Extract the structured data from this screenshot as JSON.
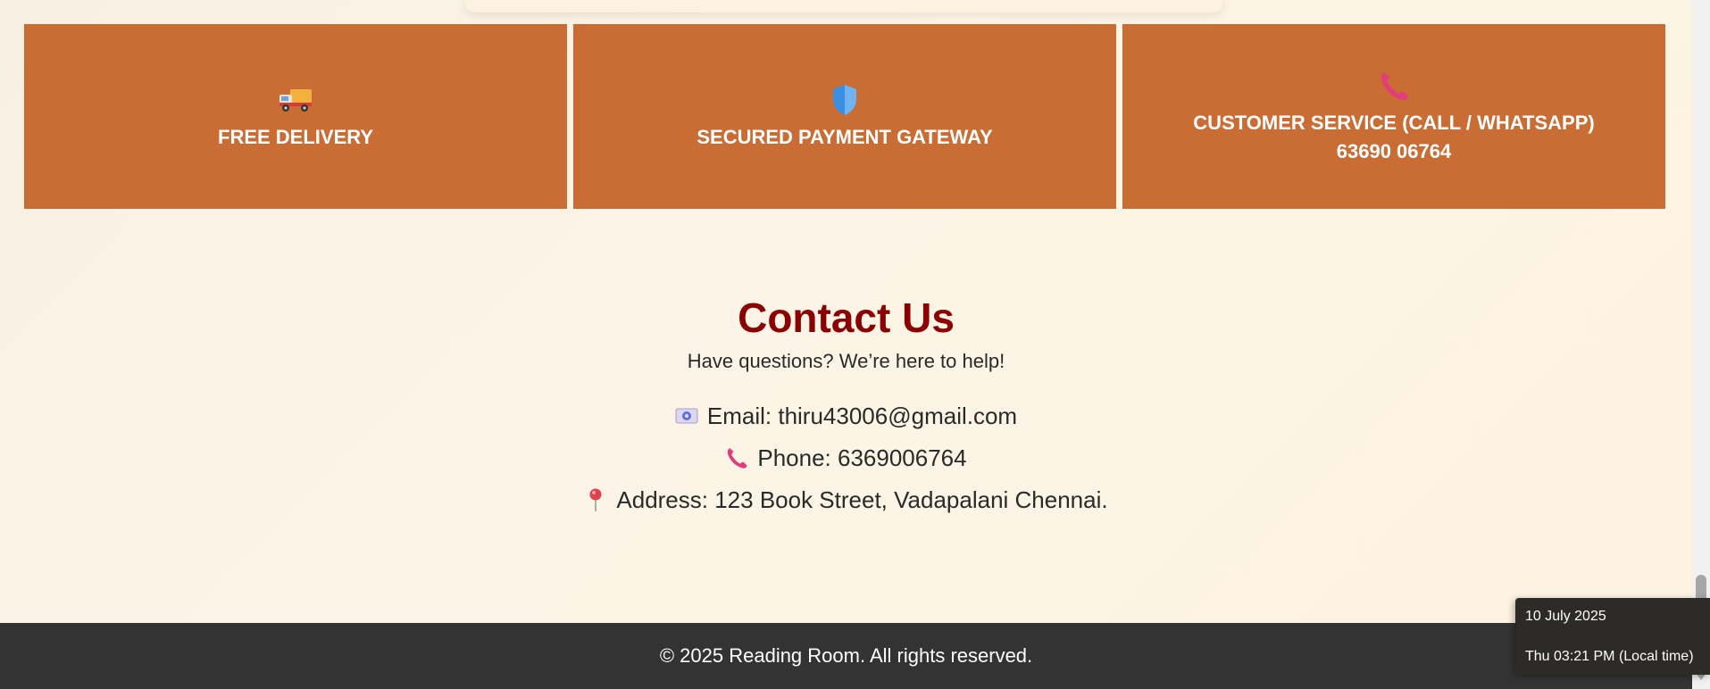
{
  "features": [
    {
      "icon": "delivery-truck-icon",
      "title_lines": [
        "FREE DELIVERY"
      ]
    },
    {
      "icon": "shield-icon",
      "title_lines": [
        "SECURED PAYMENT GATEWAY"
      ]
    },
    {
      "icon": "phone-icon",
      "title_lines": [
        "CUSTOMER SERVICE (CALL / WHATSAPP)",
        "63690 06764"
      ]
    }
  ],
  "contact": {
    "title": "Contact Us",
    "subtitle": "Have questions? We’re here to help!",
    "email": "Email: thiru43006@gmail.com",
    "phone": "Phone: 6369006764",
    "address": "Address: 123 Book Street, Vadapalani Chennai.",
    "icons": {
      "email": "envelope-icon",
      "phone": "phone-icon",
      "address": "location-pin-icon"
    }
  },
  "footer": {
    "copyright": "© 2025 Reading Room. All rights reserved."
  },
  "clock_tooltip": {
    "date": "10 July 2025",
    "time": "Thu 03:21 PM (Local time)"
  },
  "colors": {
    "feature_bg": "#c96d35",
    "heading": "#8b0000",
    "footer_bg": "#333333",
    "page_bg": "#fcf4e6"
  }
}
